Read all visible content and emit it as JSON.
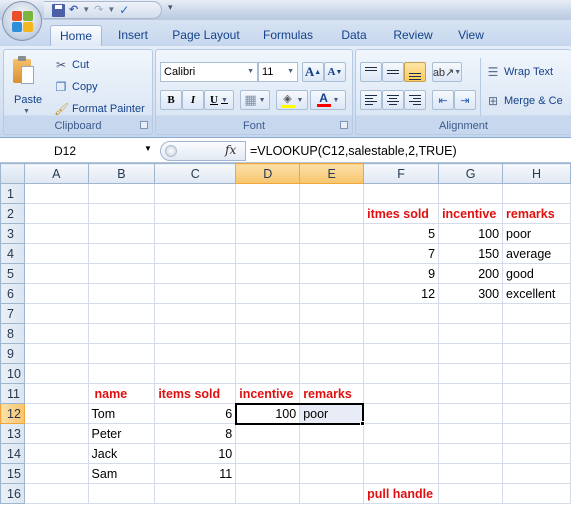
{
  "quick_access": {
    "save_icon": "save-icon",
    "undo_icon": "undo-icon",
    "redo_icon": "redo-icon",
    "spelling_icon": "spelling-icon",
    "customize_icon": "customize-qat-icon"
  },
  "tabs": [
    {
      "label": "Home",
      "active": true
    },
    {
      "label": "Insert"
    },
    {
      "label": "Page Layout"
    },
    {
      "label": "Formulas"
    },
    {
      "label": "Data"
    },
    {
      "label": "Review"
    },
    {
      "label": "View"
    }
  ],
  "ribbon": {
    "clipboard": {
      "paste": "Paste",
      "cut": "Cut",
      "copy": "Copy",
      "format_painter": "Format Painter",
      "label": "Clipboard"
    },
    "font": {
      "font_name": "Calibri",
      "font_size": "11",
      "grow": "A",
      "shrink": "A",
      "bold": "B",
      "italic": "I",
      "underline": "U",
      "fill_color": "#ffff00",
      "font_color": "#ff0000",
      "label": "Font"
    },
    "alignment": {
      "wrap_text": "Wrap Text",
      "merge_center": "Merge & Ce",
      "label": "Alignment"
    }
  },
  "formula_bar": {
    "name_box": "D12",
    "fx": "fx",
    "formula": "=VLOOKUP(C12,salestable,2,TRUE)"
  },
  "sheet": {
    "columns": [
      "A",
      "B",
      "C",
      "D",
      "E",
      "F",
      "G",
      "H"
    ],
    "active_column": "D",
    "active_row": 12,
    "rows": [
      {
        "n": "1",
        "cells": [
          "",
          "",
          "",
          "",
          "",
          "",
          "",
          ""
        ]
      },
      {
        "n": "2",
        "cells": [
          "",
          "",
          "",
          "",
          "",
          "itmes sold",
          "incentive",
          "remarks"
        ]
      },
      {
        "n": "3",
        "cells": [
          "",
          "",
          "",
          "",
          "",
          "5",
          "100",
          "poor"
        ]
      },
      {
        "n": "4",
        "cells": [
          "",
          "",
          "",
          "",
          "",
          "7",
          "150",
          "average"
        ]
      },
      {
        "n": "5",
        "cells": [
          "",
          "",
          "",
          "",
          "",
          "9",
          "200",
          "good"
        ]
      },
      {
        "n": "6",
        "cells": [
          "",
          "",
          "",
          "",
          "",
          "12",
          "300",
          "excellent"
        ]
      },
      {
        "n": "7",
        "cells": [
          "",
          "",
          "",
          "",
          "",
          "",
          "",
          ""
        ]
      },
      {
        "n": "8",
        "cells": [
          "",
          "",
          "",
          "",
          "",
          "",
          "",
          ""
        ]
      },
      {
        "n": "9",
        "cells": [
          "",
          "",
          "",
          "",
          "",
          "",
          "",
          ""
        ]
      },
      {
        "n": "10",
        "cells": [
          "",
          "",
          "",
          "",
          "",
          "",
          "",
          ""
        ]
      },
      {
        "n": "11",
        "cells": [
          "",
          "name",
          "items sold",
          "incentive",
          "remarks",
          "",
          "",
          ""
        ]
      },
      {
        "n": "12",
        "cells": [
          "",
          "Tom",
          "6",
          "100",
          "poor",
          "",
          "",
          ""
        ]
      },
      {
        "n": "13",
        "cells": [
          "",
          "Peter",
          "8",
          "",
          "",
          "",
          "",
          ""
        ]
      },
      {
        "n": "14",
        "cells": [
          "",
          "Jack",
          "10",
          "",
          "",
          "",
          "",
          ""
        ]
      },
      {
        "n": "15",
        "cells": [
          "",
          "Sam",
          "11",
          "",
          "",
          "",
          "",
          ""
        ]
      },
      {
        "n": "16",
        "cells": [
          "",
          "",
          "",
          "",
          "",
          "pull handle",
          "",
          ""
        ]
      }
    ],
    "accent_header_color": "#e01010"
  }
}
